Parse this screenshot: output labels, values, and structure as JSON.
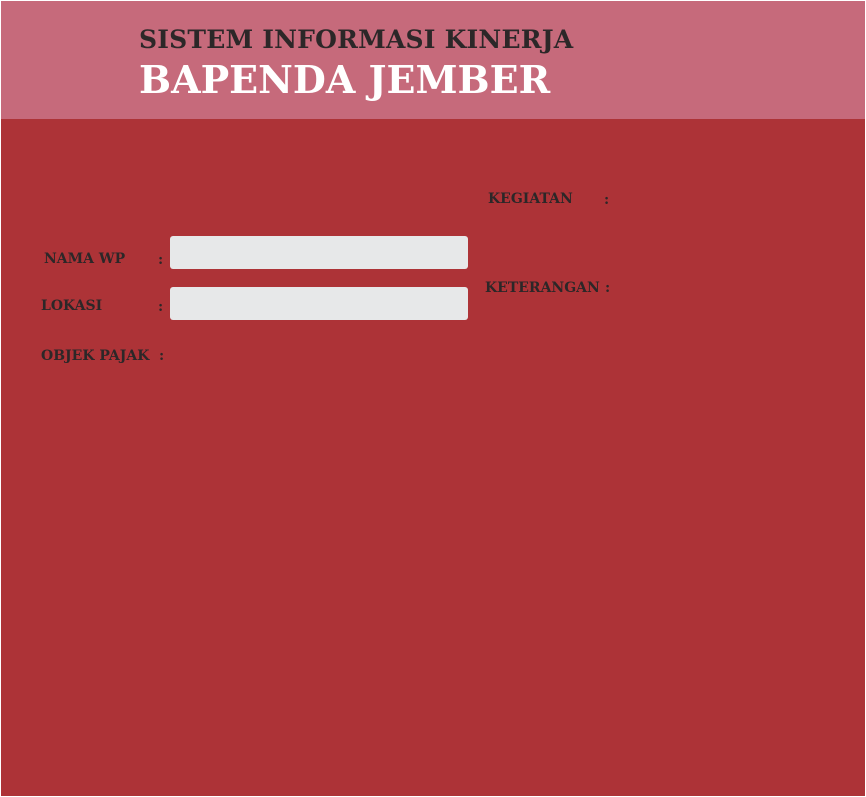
{
  "header": {
    "subtitle": "SISTEM INFORMASI KINERJA",
    "title": "BAPENDA JEMBER"
  },
  "form": {
    "nama_wp": {
      "label": "NAMA WP",
      "colon": ":",
      "value": "",
      "placeholder": ""
    },
    "lokasi": {
      "label": "LOKASI",
      "colon": ":",
      "value": "",
      "placeholder": ""
    },
    "objek_pajak": {
      "label": "OBJEK PAJAK",
      "colon": ":"
    },
    "kegiatan": {
      "label": "KEGIATAN",
      "colon": ":"
    },
    "keterangan": {
      "label": "KETERANGAN",
      "colon": ":"
    }
  },
  "colors": {
    "header_bg": "#c66a7b",
    "body_bg": "#ad3337",
    "field_bg": "#e7e8e9",
    "label_text": "#2c2728",
    "title_text": "#ffffff"
  }
}
